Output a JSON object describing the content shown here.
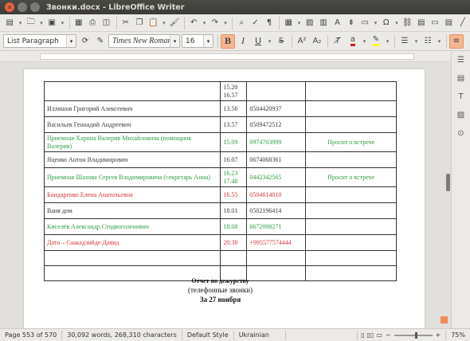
{
  "window": {
    "title": "Звонки.docx - LibreOffice Writer"
  },
  "formatting": {
    "paragraph_style": "List Paragraph",
    "font_name": "Times New Roman",
    "font_size": "16"
  },
  "toolbar_icons": [
    "new-icon",
    "open-icon",
    "save-icon",
    "export-pdf-icon",
    "print-icon",
    "print-preview-icon",
    "cut-icon",
    "copy-icon",
    "paste-icon",
    "clone-formatting-icon",
    "undo-icon",
    "redo-icon",
    "find-replace-icon",
    "spelling-icon",
    "formatting-marks-icon",
    "insert-table-icon",
    "insert-image-icon",
    "insert-chart-icon",
    "insert-textbox-icon",
    "insert-page-break-icon",
    "insert-field-icon",
    "special-character-icon",
    "hyperlink-icon",
    "footnote-icon",
    "comment-icon",
    "track-changes-icon",
    "draw-shapes-icon"
  ],
  "table": {
    "rows": [
      {
        "name": "",
        "time": [
          "15.20",
          "16.57"
        ],
        "phone": "",
        "note": "",
        "color": "black"
      },
      {
        "name": "Илляшов Григорий Алексеевич",
        "time": [
          "13.56"
        ],
        "phone": "0504420937",
        "note": "",
        "color": "black"
      },
      {
        "name": "Васильев Геннадий Андреевич",
        "time": [
          "13.57"
        ],
        "phone": "0509472512",
        "note": "",
        "color": "black"
      },
      {
        "name": "Приемная Харина Валерия Михайловича  (помощник Валерия)",
        "time": [
          "15.09"
        ],
        "phone": "0974703999",
        "note": "Просит о встрече",
        "color": "green"
      },
      {
        "name": "Яценко Антон Владимирович",
        "time": [
          "16.07"
        ],
        "phone": "0674068361",
        "note": "",
        "color": "black"
      },
      {
        "name": "Приемная Шахова Сергея Владимировича (секретарь Анна)",
        "time": [
          "16.23",
          "17.48"
        ],
        "phone": "0442342565",
        "note": "Просит о встрече",
        "color": "green"
      },
      {
        "name": "Бондаренко Елена Анатольевна",
        "time": [
          "16.55"
        ],
        "phone": "0504614010",
        "note": "",
        "color": "red"
      },
      {
        "name": "Ваня дом",
        "time": [
          "18.01"
        ],
        "phone": "0502196414",
        "note": "",
        "color": "black"
      },
      {
        "name": "Киселёв Александр Стодвоголенович",
        "time": [
          "18.08"
        ],
        "phone": "0672098271",
        "note": "",
        "color": "green"
      },
      {
        "name": "Дато – Саакадзийде Давид",
        "time": [
          "20.38"
        ],
        "phone": "+995577574444",
        "note": "",
        "color": "red"
      },
      {
        "name": "",
        "time": [
          ""
        ],
        "phone": "",
        "note": "",
        "color": "black"
      },
      {
        "name": "",
        "time": [
          ""
        ],
        "phone": "",
        "note": "",
        "color": "black"
      }
    ]
  },
  "report": {
    "title": "Отчет по дежурству",
    "subtitle": "(телефонные звонки)",
    "date": "За 27 ноября"
  },
  "statusbar": {
    "page": "Page 553 of 570",
    "words": "30,092 words, 268,310 characters",
    "page_style": "Default Style",
    "language": "Ukrainian",
    "zoom": "75%"
  }
}
